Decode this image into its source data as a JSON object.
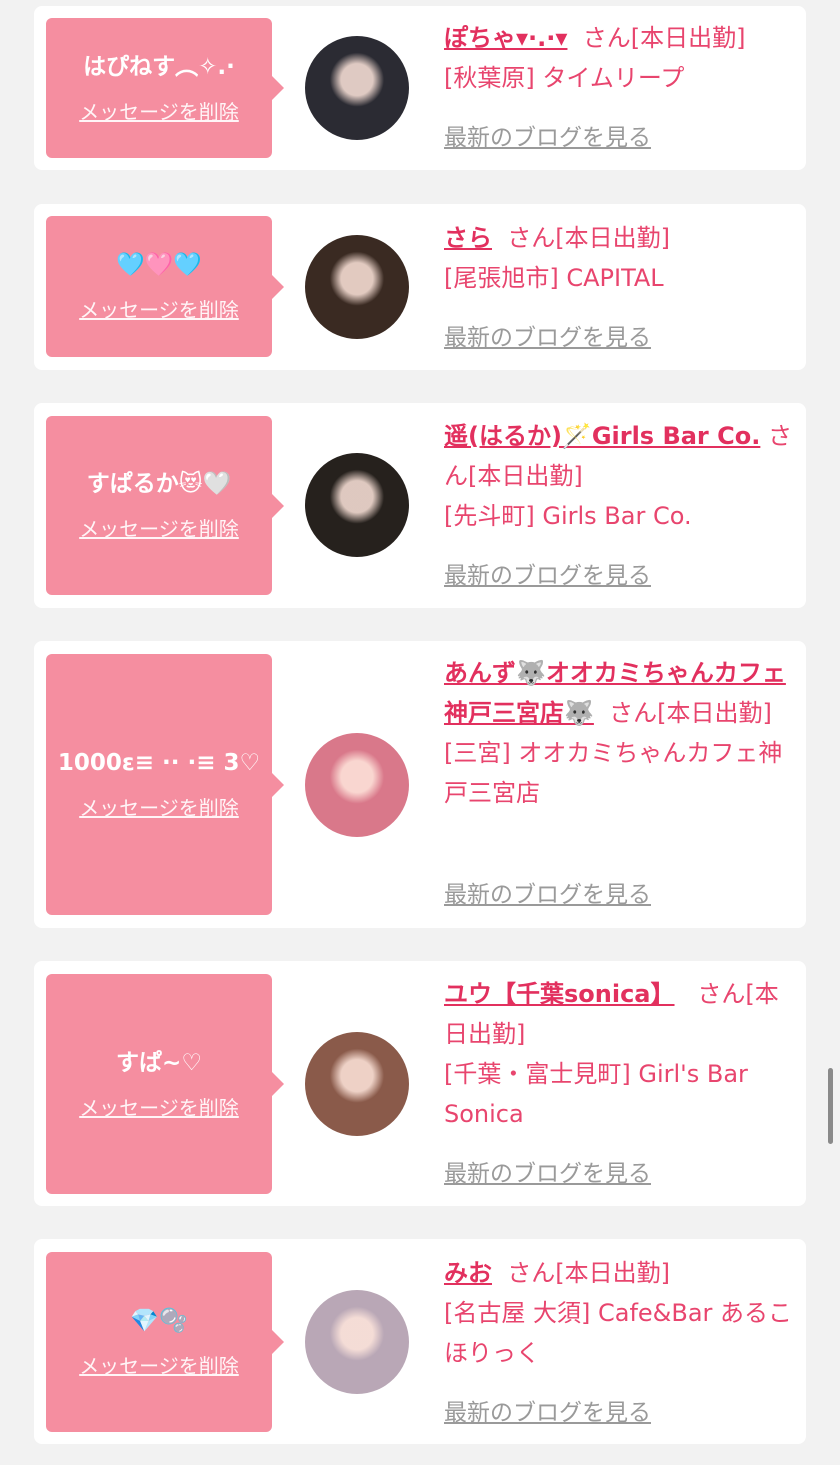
{
  "status_label": "[本日出勤]",
  "san_label": "さん",
  "delete_label": "メッセージを削除",
  "blog_label": "最新のブログを見る",
  "colors": {
    "bubble": "#f58ea0",
    "name": "#e2305e",
    "text": "#e8456e",
    "link_gray": "#9a9a9a"
  },
  "cards": [
    {
      "message": "はぴねす︵✧.·",
      "name": "ぽちゃ▾·.·▾",
      "location": "[秋葉原] タイムリープ",
      "avatar_color": "#2b2b33"
    },
    {
      "message": "🩵🩷🩵",
      "name": "さら",
      "location": "[尾張旭市] CAPITAL",
      "avatar_color": "#3a2a22"
    },
    {
      "message": "すぱるか😻🤍",
      "name": "遥(はるか)🪄Girls Bar Co.",
      "location": "[先斗町] Girls Bar Co.",
      "avatar_color": "#26211d"
    },
    {
      "message": "1000ε≡ ·· ·≡ 3♡",
      "name": "あんず🐺オオカミちゃんカフェ神戸三宮店🐺",
      "location": "[三宮] オオカミちゃんカフェ神戸三宮店",
      "avatar_color": "#d9788a"
    },
    {
      "message": "すぱ~♡",
      "name": "ユウ【千葉sonica】",
      "location": "[千葉・富士見町] Girl's Bar Sonica",
      "avatar_color": "#8a5a4a"
    },
    {
      "message": "💎🫧",
      "name": "みお",
      "location": "[名古屋 大須] Cafe&Bar あるこほりっく",
      "avatar_color": "#b9a7b6"
    }
  ]
}
